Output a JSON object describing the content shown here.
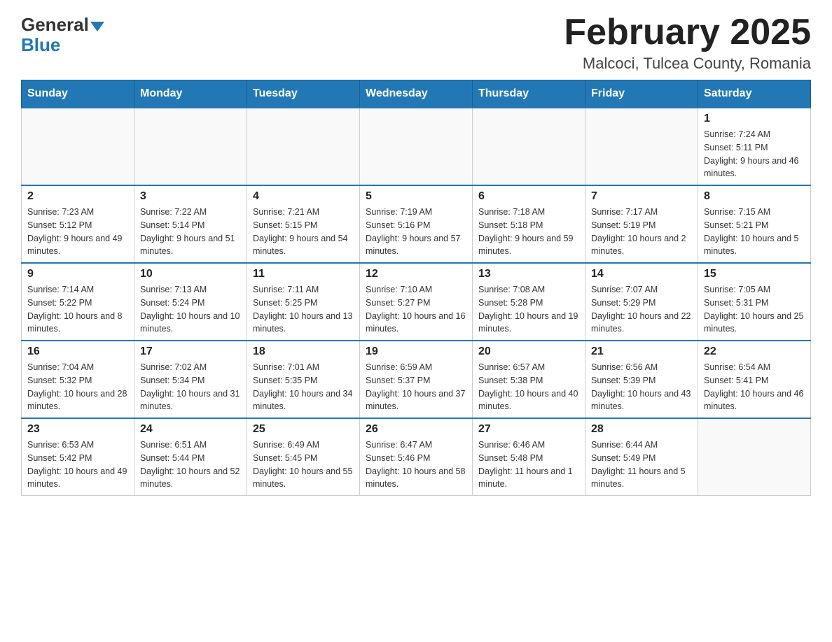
{
  "header": {
    "logo_text_general": "General",
    "logo_text_blue": "Blue",
    "month_title": "February 2025",
    "location": "Malcoci, Tulcea County, Romania"
  },
  "days_of_week": [
    "Sunday",
    "Monday",
    "Tuesday",
    "Wednesday",
    "Thursday",
    "Friday",
    "Saturday"
  ],
  "weeks": [
    [
      {
        "day": "",
        "info": ""
      },
      {
        "day": "",
        "info": ""
      },
      {
        "day": "",
        "info": ""
      },
      {
        "day": "",
        "info": ""
      },
      {
        "day": "",
        "info": ""
      },
      {
        "day": "",
        "info": ""
      },
      {
        "day": "1",
        "info": "Sunrise: 7:24 AM\nSunset: 5:11 PM\nDaylight: 9 hours and 46 minutes."
      }
    ],
    [
      {
        "day": "2",
        "info": "Sunrise: 7:23 AM\nSunset: 5:12 PM\nDaylight: 9 hours and 49 minutes."
      },
      {
        "day": "3",
        "info": "Sunrise: 7:22 AM\nSunset: 5:14 PM\nDaylight: 9 hours and 51 minutes."
      },
      {
        "day": "4",
        "info": "Sunrise: 7:21 AM\nSunset: 5:15 PM\nDaylight: 9 hours and 54 minutes."
      },
      {
        "day": "5",
        "info": "Sunrise: 7:19 AM\nSunset: 5:16 PM\nDaylight: 9 hours and 57 minutes."
      },
      {
        "day": "6",
        "info": "Sunrise: 7:18 AM\nSunset: 5:18 PM\nDaylight: 9 hours and 59 minutes."
      },
      {
        "day": "7",
        "info": "Sunrise: 7:17 AM\nSunset: 5:19 PM\nDaylight: 10 hours and 2 minutes."
      },
      {
        "day": "8",
        "info": "Sunrise: 7:15 AM\nSunset: 5:21 PM\nDaylight: 10 hours and 5 minutes."
      }
    ],
    [
      {
        "day": "9",
        "info": "Sunrise: 7:14 AM\nSunset: 5:22 PM\nDaylight: 10 hours and 8 minutes."
      },
      {
        "day": "10",
        "info": "Sunrise: 7:13 AM\nSunset: 5:24 PM\nDaylight: 10 hours and 10 minutes."
      },
      {
        "day": "11",
        "info": "Sunrise: 7:11 AM\nSunset: 5:25 PM\nDaylight: 10 hours and 13 minutes."
      },
      {
        "day": "12",
        "info": "Sunrise: 7:10 AM\nSunset: 5:27 PM\nDaylight: 10 hours and 16 minutes."
      },
      {
        "day": "13",
        "info": "Sunrise: 7:08 AM\nSunset: 5:28 PM\nDaylight: 10 hours and 19 minutes."
      },
      {
        "day": "14",
        "info": "Sunrise: 7:07 AM\nSunset: 5:29 PM\nDaylight: 10 hours and 22 minutes."
      },
      {
        "day": "15",
        "info": "Sunrise: 7:05 AM\nSunset: 5:31 PM\nDaylight: 10 hours and 25 minutes."
      }
    ],
    [
      {
        "day": "16",
        "info": "Sunrise: 7:04 AM\nSunset: 5:32 PM\nDaylight: 10 hours and 28 minutes."
      },
      {
        "day": "17",
        "info": "Sunrise: 7:02 AM\nSunset: 5:34 PM\nDaylight: 10 hours and 31 minutes."
      },
      {
        "day": "18",
        "info": "Sunrise: 7:01 AM\nSunset: 5:35 PM\nDaylight: 10 hours and 34 minutes."
      },
      {
        "day": "19",
        "info": "Sunrise: 6:59 AM\nSunset: 5:37 PM\nDaylight: 10 hours and 37 minutes."
      },
      {
        "day": "20",
        "info": "Sunrise: 6:57 AM\nSunset: 5:38 PM\nDaylight: 10 hours and 40 minutes."
      },
      {
        "day": "21",
        "info": "Sunrise: 6:56 AM\nSunset: 5:39 PM\nDaylight: 10 hours and 43 minutes."
      },
      {
        "day": "22",
        "info": "Sunrise: 6:54 AM\nSunset: 5:41 PM\nDaylight: 10 hours and 46 minutes."
      }
    ],
    [
      {
        "day": "23",
        "info": "Sunrise: 6:53 AM\nSunset: 5:42 PM\nDaylight: 10 hours and 49 minutes."
      },
      {
        "day": "24",
        "info": "Sunrise: 6:51 AM\nSunset: 5:44 PM\nDaylight: 10 hours and 52 minutes."
      },
      {
        "day": "25",
        "info": "Sunrise: 6:49 AM\nSunset: 5:45 PM\nDaylight: 10 hours and 55 minutes."
      },
      {
        "day": "26",
        "info": "Sunrise: 6:47 AM\nSunset: 5:46 PM\nDaylight: 10 hours and 58 minutes."
      },
      {
        "day": "27",
        "info": "Sunrise: 6:46 AM\nSunset: 5:48 PM\nDaylight: 11 hours and 1 minute."
      },
      {
        "day": "28",
        "info": "Sunrise: 6:44 AM\nSunset: 5:49 PM\nDaylight: 11 hours and 5 minutes."
      },
      {
        "day": "",
        "info": ""
      }
    ]
  ]
}
